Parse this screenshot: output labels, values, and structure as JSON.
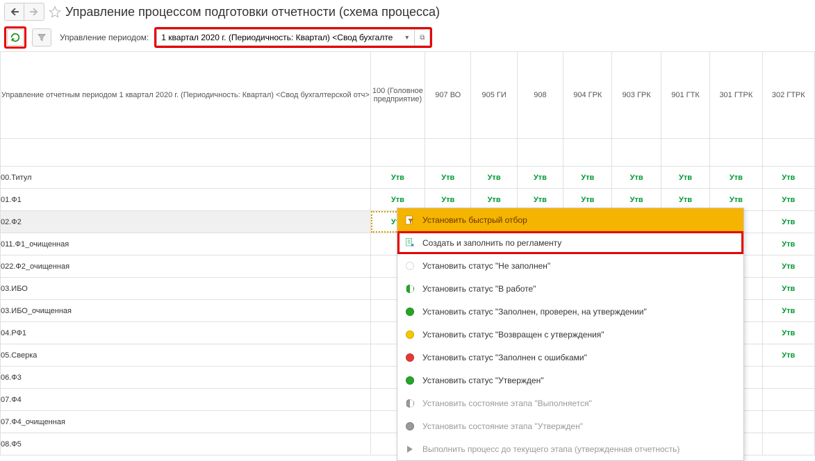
{
  "header": {
    "title": "Управление процессом подготовки отчетности (схема процесса)"
  },
  "toolbar": {
    "period_label": "Управление периодом:",
    "period_value": "1 квартал 2020 г. (Периодичность: Квартал) <Свод бухгалте"
  },
  "grid": {
    "corner_text": "Управление отчетным периодом 1 квартал 2020 г. (Периодичность: Квартал) <Свод бухгалтерской отч>",
    "columns": [
      "100 (Головное предприятие)",
      "907 ВО",
      "905 ГИ",
      "908",
      "904 ГРК",
      "903 ГРК",
      "901 ГТК",
      "301 ГТРК",
      "302 ГТРК"
    ],
    "status": "Утв",
    "rows": [
      {
        "label": "00.Титул",
        "vis": [
          1,
          1,
          1,
          1,
          1,
          1,
          1,
          1,
          1
        ]
      },
      {
        "label": "01.Ф1",
        "vis": [
          1,
          1,
          1,
          1,
          1,
          1,
          1,
          1,
          1
        ]
      },
      {
        "label": "02.Ф2",
        "vis": [
          1,
          1,
          1,
          1,
          1,
          1,
          1,
          1,
          1
        ],
        "active": true,
        "sel": true
      },
      {
        "label": "011.Ф1_очищенная",
        "vis": [
          0,
          0,
          0,
          0,
          0,
          0,
          0,
          0,
          1
        ]
      },
      {
        "label": "022.Ф2_очищенная",
        "vis": [
          0,
          0,
          0,
          0,
          0,
          0,
          0,
          0,
          1
        ]
      },
      {
        "label": "03.ИБО",
        "vis": [
          0,
          0,
          0,
          0,
          0,
          0,
          0,
          0,
          1
        ]
      },
      {
        "label": "03.ИБО_очищенная",
        "vis": [
          0,
          0,
          0,
          0,
          0,
          0,
          0,
          0,
          1
        ]
      },
      {
        "label": "04.РФ1",
        "vis": [
          0,
          0,
          0,
          0,
          0,
          0,
          0,
          0,
          1
        ]
      },
      {
        "label": "05.Сверка",
        "vis": [
          0,
          0,
          0,
          0,
          0,
          0,
          0,
          0,
          1
        ]
      },
      {
        "label": "06.Ф3",
        "vis": [
          0,
          0,
          0,
          0,
          0,
          0,
          0,
          0,
          0
        ]
      },
      {
        "label": "07.Ф4",
        "vis": [
          0,
          0,
          0,
          0,
          0,
          0,
          0,
          0,
          0
        ]
      },
      {
        "label": "07.Ф4_очищенная",
        "vis": [
          0,
          0,
          0,
          0,
          0,
          0,
          0,
          0,
          0
        ]
      },
      {
        "label": "08.Ф5",
        "vis": [
          0,
          0,
          0,
          0,
          0,
          0,
          0,
          0,
          0
        ]
      }
    ]
  },
  "context_menu": {
    "items": [
      {
        "label": "Установить быстрый отбор",
        "icon": "filter-doc",
        "state": "hover"
      },
      {
        "label": "Создать и заполнить по регламенту",
        "icon": "fill-doc",
        "state": "highlighted"
      },
      {
        "label": "Установить статус \"Не заполнен\"",
        "icon": "dot-empty"
      },
      {
        "label": "Установить статус \"В работе\"",
        "icon": "dot-half"
      },
      {
        "label": "Установить статус \"Заполнен, проверен, на утверждении\"",
        "icon": "dot-green"
      },
      {
        "label": "Установить статус \"Возвращен с утверждения\"",
        "icon": "dot-yellow"
      },
      {
        "label": "Установить статус \"Заполнен с ошибками\"",
        "icon": "dot-red"
      },
      {
        "label": "Установить статус \"Утвержден\"",
        "icon": "dot-green"
      },
      {
        "label": "Установить состояние этапа \"Выполняется\"",
        "icon": "dot-gray-half",
        "state": "disabled"
      },
      {
        "label": "Установить состояние этапа \"Утвержден\"",
        "icon": "dot-gray-full",
        "state": "disabled"
      },
      {
        "label": "Выполнить процесс до текущего этапа (утвержденная отчетность)",
        "icon": "play",
        "state": "disabled"
      }
    ]
  }
}
